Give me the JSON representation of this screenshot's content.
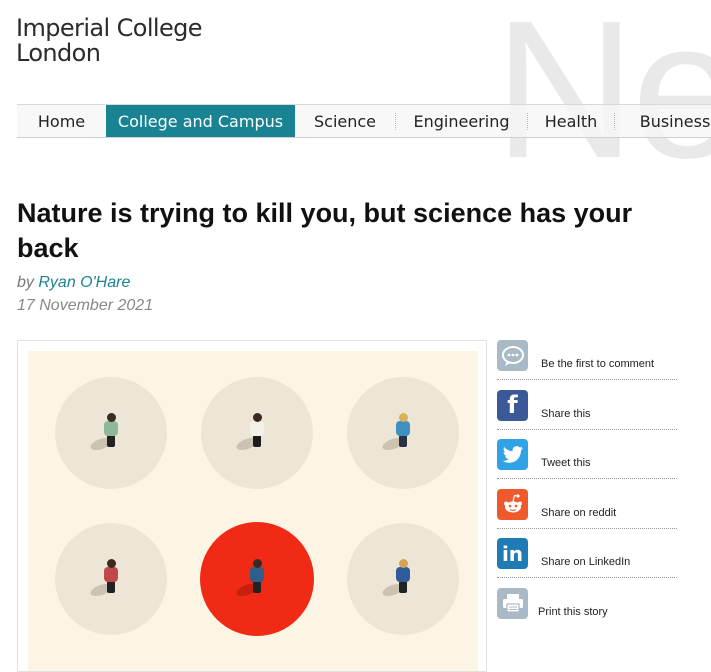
{
  "logo": {
    "line1": "Imperial College",
    "line2": "London"
  },
  "watermark": "Ne",
  "nav": {
    "items": [
      {
        "label": "Home"
      },
      {
        "label": "College and Campus"
      },
      {
        "label": "Science"
      },
      {
        "label": "Engineering"
      },
      {
        "label": "Health"
      },
      {
        "label": "Business"
      }
    ],
    "active_index": 1
  },
  "article": {
    "headline": "Nature is trying to kill you, but science has your back",
    "by_prefix": "by",
    "author": "Ryan O'Hare",
    "date": "17 November 2021"
  },
  "share": {
    "items": [
      {
        "label": "Be the first to comment",
        "icon": "comment-bubble-icon"
      },
      {
        "label": "Share this",
        "icon": "facebook-icon"
      },
      {
        "label": "Tweet this",
        "icon": "twitter-icon"
      },
      {
        "label": "Share on reddit",
        "icon": "reddit-icon"
      },
      {
        "label": "Share on LinkedIn",
        "icon": "linkedin-icon"
      },
      {
        "label": "Print this story",
        "icon": "printer-icon"
      }
    ]
  },
  "colors": {
    "accent": "#1a8393",
    "facebook": "#3b5998",
    "twitter": "#2fa3e6",
    "reddit": "#ee5a2b",
    "linkedin": "#1f7bb6",
    "neutral_icon": "#a9b9c6",
    "highlight_circle": "#f02a14",
    "image_background": "#fdf5e4"
  }
}
